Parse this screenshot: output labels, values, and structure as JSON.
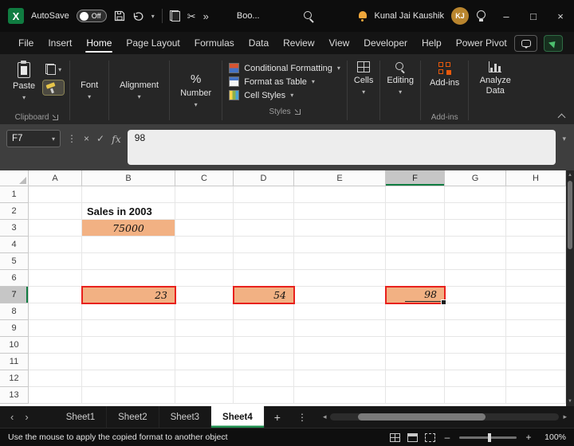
{
  "titlebar": {
    "autosave_label": "AutoSave",
    "autosave_state": "Off",
    "doc_name": "Boo...",
    "user_name": "Kunal Jai Kaushik",
    "user_initials": "KJ"
  },
  "menu": {
    "items": [
      "File",
      "Insert",
      "Home",
      "Page Layout",
      "Formulas",
      "Data",
      "Review",
      "View",
      "Developer",
      "Help",
      "Power Pivot"
    ],
    "active": "Home"
  },
  "ribbon": {
    "paste_label": "Paste",
    "font_label": "Font",
    "alignment_label": "Alignment",
    "number_label": "Number",
    "conditional_formatting_label": "Conditional Formatting",
    "format_as_table_label": "Format as Table",
    "cell_styles_label": "Cell Styles",
    "cells_label": "Cells",
    "editing_label": "Editing",
    "addins_label": "Add-ins",
    "analyze_data_label": "Analyze Data",
    "groups": {
      "clipboard": "Clipboard",
      "styles": "Styles",
      "addins": "Add-ins"
    }
  },
  "formula_bar": {
    "name_box": "F7",
    "fx_label": "fx",
    "value": "98"
  },
  "grid": {
    "columns": [
      "A",
      "B",
      "C",
      "D",
      "E",
      "F",
      "G",
      "H"
    ],
    "rows": [
      "1",
      "2",
      "3",
      "4",
      "5",
      "6",
      "7",
      "8",
      "9",
      "10",
      "11",
      "12",
      "13"
    ],
    "selected_column": "F",
    "selected_row": "7",
    "cells": [
      {
        "ref": "B2",
        "value": "Sales in 2003",
        "style": "title"
      },
      {
        "ref": "B3",
        "value": "75000",
        "style": "filled centered"
      },
      {
        "ref": "B7",
        "value": "23",
        "style": "filled outlined"
      },
      {
        "ref": "D7",
        "value": "54",
        "style": "filled outlined"
      },
      {
        "ref": "F7",
        "value": "98",
        "style": "filled outlined active underlined"
      }
    ]
  },
  "sheet_tabs": {
    "tabs": [
      "Sheet1",
      "Sheet2",
      "Sheet3",
      "Sheet4"
    ],
    "active": "Sheet4",
    "add_label": "+"
  },
  "status_bar": {
    "message": "Use the mouse to apply the copied format to another object",
    "zoom": "100%"
  },
  "icons": {
    "chevron_down": "▾",
    "more": "»",
    "scissors": "✂",
    "ellipsis_v": "⋮",
    "close": "×",
    "check": "✓",
    "minimize": "–",
    "maximize": "□",
    "window_close": "×",
    "nav_left": "‹",
    "nav_right": "›",
    "tri_left": "◂",
    "tri_right": "▸",
    "tri_up": "▲",
    "tri_down": "▼",
    "plus": "+",
    "minus": "–",
    "percent": "%",
    "excel_logo": "X"
  },
  "colors": {
    "accent_green": "#107C41",
    "cell_fill": "#F2B183",
    "copy_outline_red": "#E8211D"
  }
}
